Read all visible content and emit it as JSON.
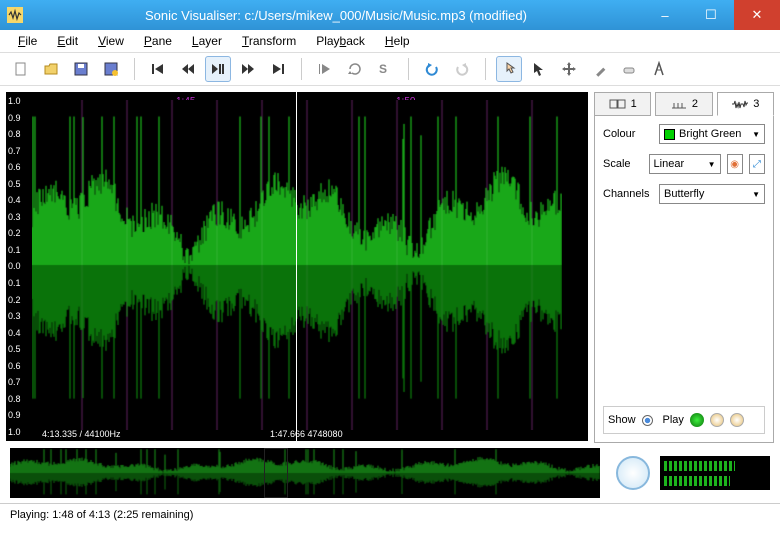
{
  "window": {
    "title": "Sonic Visualiser: c:/Users/mikew_000/Music/Music.mp3 (modified)"
  },
  "menu": {
    "file": "File",
    "edit": "Edit",
    "view": "View",
    "pane": "Pane",
    "layer": "Layer",
    "transform": "Transform",
    "playback": "Playback",
    "help": "Help"
  },
  "waveform": {
    "y_labels_top": [
      "1.0",
      "0.9",
      "0.8",
      "0.7",
      "0.6",
      "0.5",
      "0.4",
      "0.3",
      "0.2",
      "0.1",
      "0.0"
    ],
    "y_labels_bot": [
      "0.1",
      "0.2",
      "0.3",
      "0.4",
      "0.5",
      "0.6",
      "0.7",
      "0.8",
      "0.9",
      "1.0"
    ],
    "time_labels": [
      "1:45",
      "1:50"
    ],
    "readout_left": "4:13.335 / 44100Hz",
    "readout_cursor": "1:47.666   4748080"
  },
  "tabs": {
    "t1": "1",
    "t2": "2",
    "t3": "3"
  },
  "props": {
    "colour_label": "Colour",
    "colour_value": "Bright Green",
    "scale_label": "Scale",
    "scale_value": "Linear",
    "channels_label": "Channels",
    "channels_value": "Butterfly",
    "show_label": "Show",
    "play_label": "Play"
  },
  "status": {
    "text": "Playing: 1:48 of 4:13 (2:25 remaining)"
  }
}
